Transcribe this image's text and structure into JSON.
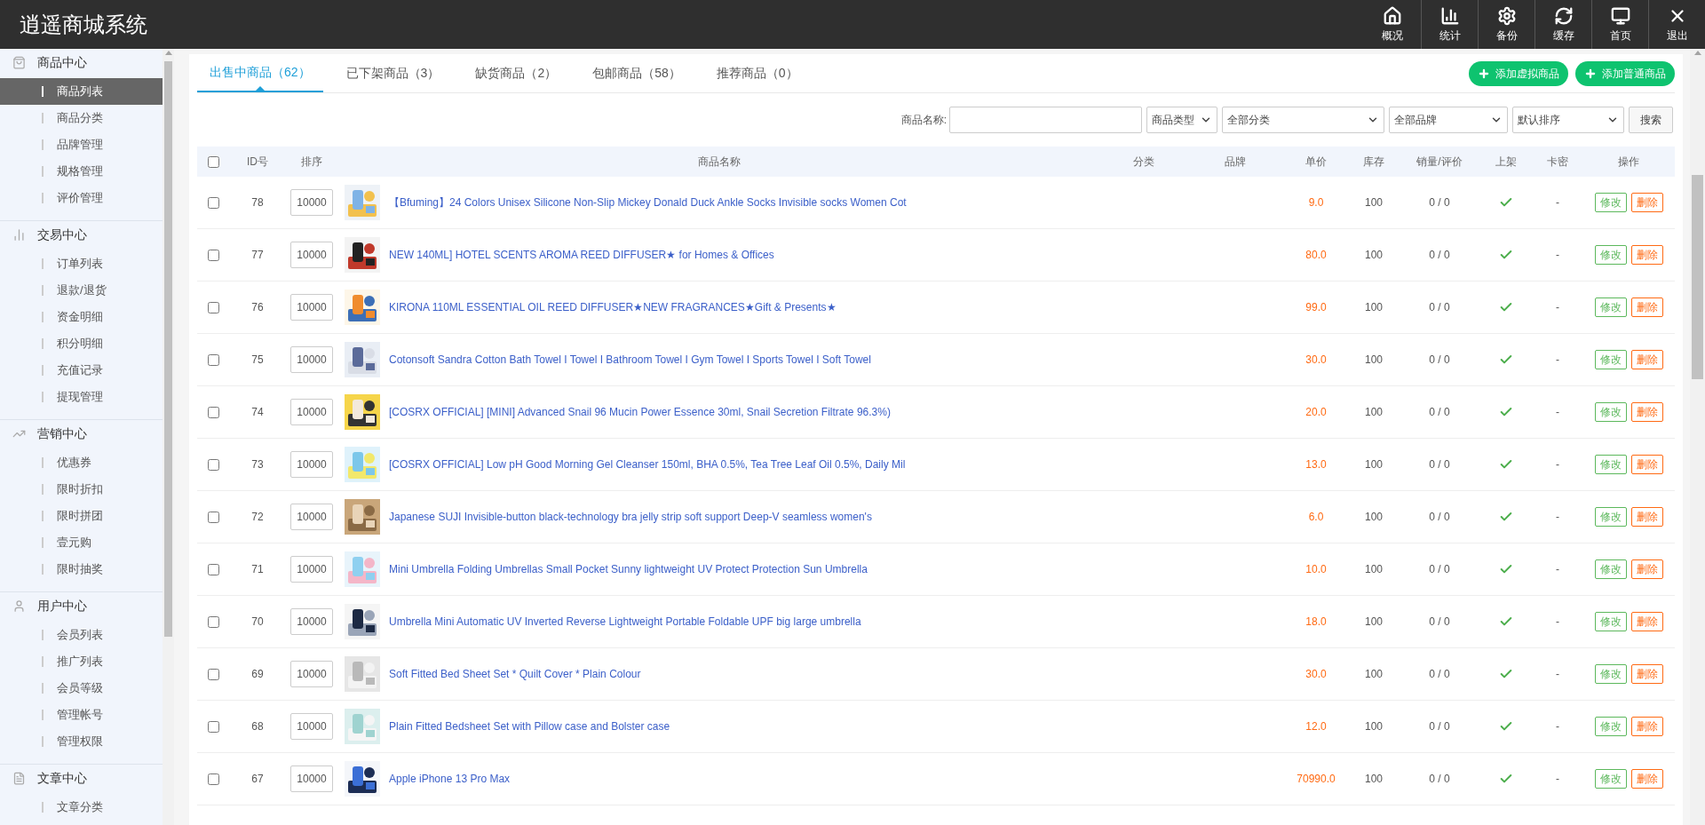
{
  "app": {
    "title": "逍遥商城系统"
  },
  "top_nav": [
    {
      "label": "概况",
      "kind": "home"
    },
    {
      "label": "统计",
      "kind": "stats"
    },
    {
      "label": "备份",
      "kind": "gear"
    },
    {
      "label": "缓存",
      "kind": "refresh"
    },
    {
      "label": "首页",
      "kind": "monitor"
    },
    {
      "label": "退出",
      "kind": "close"
    }
  ],
  "sidebar": {
    "groups": [
      {
        "title": "商品中心",
        "kind": "bag",
        "items": [
          {
            "label": "商品列表",
            "selected": true
          },
          {
            "label": "商品分类",
            "selected": false
          },
          {
            "label": "品牌管理",
            "selected": false
          },
          {
            "label": "规格管理",
            "selected": false
          },
          {
            "label": "评价管理",
            "selected": false
          }
        ]
      },
      {
        "title": "交易中心",
        "kind": "bars",
        "items": [
          {
            "label": "订单列表",
            "selected": false
          },
          {
            "label": "退款/退货",
            "selected": false
          },
          {
            "label": "资金明细",
            "selected": false
          },
          {
            "label": "积分明细",
            "selected": false
          },
          {
            "label": "充值记录",
            "selected": false
          },
          {
            "label": "提现管理",
            "selected": false
          }
        ]
      },
      {
        "title": "营销中心",
        "kind": "trend",
        "items": [
          {
            "label": "优惠券",
            "selected": false
          },
          {
            "label": "限时折扣",
            "selected": false
          },
          {
            "label": "限时拼团",
            "selected": false
          },
          {
            "label": "壹元购",
            "selected": false
          },
          {
            "label": "限时抽奖",
            "selected": false
          }
        ]
      },
      {
        "title": "用户中心",
        "kind": "user",
        "items": [
          {
            "label": "会员列表",
            "selected": false
          },
          {
            "label": "推广列表",
            "selected": false
          },
          {
            "label": "会员等级",
            "selected": false
          },
          {
            "label": "管理帐号",
            "selected": false
          },
          {
            "label": "管理权限",
            "selected": false
          }
        ]
      },
      {
        "title": "文章中心",
        "kind": "doc",
        "items": [
          {
            "label": "文章分类",
            "selected": false
          }
        ]
      }
    ]
  },
  "tabs": [
    {
      "label": "出售中商品（62）",
      "selected": true
    },
    {
      "label": "已下架商品（3）",
      "selected": false
    },
    {
      "label": "缺货商品（2）",
      "selected": false
    },
    {
      "label": "包邮商品（58）",
      "selected": false
    },
    {
      "label": "推荐商品（0）",
      "selected": false
    }
  ],
  "actions": [
    {
      "label": "添加虚拟商品"
    },
    {
      "label": "添加普通商品"
    }
  ],
  "filters": {
    "name_label": "商品名称:",
    "selects": [
      "商品类型",
      "全部分类",
      "全部品牌",
      "默认排序"
    ],
    "search_button": "搜索"
  },
  "table": {
    "select_all_checked": false,
    "columns": [
      "ID号",
      "排序",
      "商品名称",
      "分类",
      "品牌",
      "单价",
      "库存",
      "销量/评价",
      "上架",
      "卡密",
      "操作"
    ],
    "rows": [
      {
        "checked": false,
        "id": "78",
        "sort": "10000",
        "name": "【Bfuming】24 Colors Unisex Silicone Non-Slip Mickey Donald Duck Ankle Socks Invisible socks Women Cot",
        "price": "9.0",
        "stock": "100",
        "sales": "0 / 0",
        "listed": true,
        "card": "-",
        "edit": "修改",
        "delete": "删除"
      },
      {
        "checked": false,
        "id": "77",
        "sort": "10000",
        "name": "NEW 140ML] HOTEL SCENTS AROMA REED DIFFUSER★ for Homes & Offices",
        "price": "80.0",
        "stock": "100",
        "sales": "0 / 0",
        "listed": true,
        "card": "-",
        "edit": "修改",
        "delete": "删除"
      },
      {
        "checked": false,
        "id": "76",
        "sort": "10000",
        "name": "KIRONA 110ML ESSENTIAL OIL REED DIFFUSER★NEW FRAGRANCES★Gift & Presents★",
        "price": "99.0",
        "stock": "100",
        "sales": "0 / 0",
        "listed": true,
        "card": "-",
        "edit": "修改",
        "delete": "删除"
      },
      {
        "checked": false,
        "id": "75",
        "sort": "10000",
        "name": "Cotonsoft Sandra Cotton Bath Towel I Towel I Bathroom Towel I Gym Towel I Sports Towel I Soft Towel",
        "price": "30.0",
        "stock": "100",
        "sales": "0 / 0",
        "listed": true,
        "card": "-",
        "edit": "修改",
        "delete": "删除"
      },
      {
        "checked": false,
        "id": "74",
        "sort": "10000",
        "name": "[COSRX OFFICIAL] [MINI] Advanced Snail 96 Mucin Power Essence 30ml, Snail Secretion Filtrate 96.3%)",
        "price": "20.0",
        "stock": "100",
        "sales": "0 / 0",
        "listed": true,
        "card": "-",
        "edit": "修改",
        "delete": "删除"
      },
      {
        "checked": false,
        "id": "73",
        "sort": "10000",
        "name": "[COSRX OFFICIAL] Low pH Good Morning Gel Cleanser 150ml, BHA 0.5%, Tea Tree Leaf Oil 0.5%, Daily Mil",
        "price": "13.0",
        "stock": "100",
        "sales": "0 / 0",
        "listed": true,
        "card": "-",
        "edit": "修改",
        "delete": "删除"
      },
      {
        "checked": false,
        "id": "72",
        "sort": "10000",
        "name": "Japanese SUJI Invisible-button black-technology bra jelly strip soft support Deep-V seamless women's",
        "price": "6.0",
        "stock": "100",
        "sales": "0 / 0",
        "listed": true,
        "card": "-",
        "edit": "修改",
        "delete": "删除"
      },
      {
        "checked": false,
        "id": "71",
        "sort": "10000",
        "name": "Mini Umbrella Folding Umbrellas Small Pocket Sunny lightweight UV Protect Protection Sun Umbrella",
        "price": "10.0",
        "stock": "100",
        "sales": "0 / 0",
        "listed": true,
        "card": "-",
        "edit": "修改",
        "delete": "删除"
      },
      {
        "checked": false,
        "id": "70",
        "sort": "10000",
        "name": "Umbrella Mini Automatic UV Inverted Reverse Lightweight Portable Foldable UPF big large umbrella",
        "price": "18.0",
        "stock": "100",
        "sales": "0 / 0",
        "listed": true,
        "card": "-",
        "edit": "修改",
        "delete": "删除"
      },
      {
        "checked": false,
        "id": "69",
        "sort": "10000",
        "name": "Soft Fitted Bed Sheet Set * Quilt Cover * Plain Colour",
        "price": "30.0",
        "stock": "100",
        "sales": "0 / 0",
        "listed": true,
        "card": "-",
        "edit": "修改",
        "delete": "删除"
      },
      {
        "checked": false,
        "id": "68",
        "sort": "10000",
        "name": "Plain Fitted Bedsheet Set with Pillow case and Bolster case",
        "price": "12.0",
        "stock": "100",
        "sales": "0 / 0",
        "listed": true,
        "card": "-",
        "edit": "修改",
        "delete": "删除"
      },
      {
        "checked": false,
        "id": "67",
        "sort": "10000",
        "name": "Apple iPhone 13 Pro Max",
        "price": "70990.0",
        "stock": "100",
        "sales": "0 / 0",
        "listed": true,
        "card": "-",
        "edit": "修改",
        "delete": "删除"
      }
    ]
  }
}
